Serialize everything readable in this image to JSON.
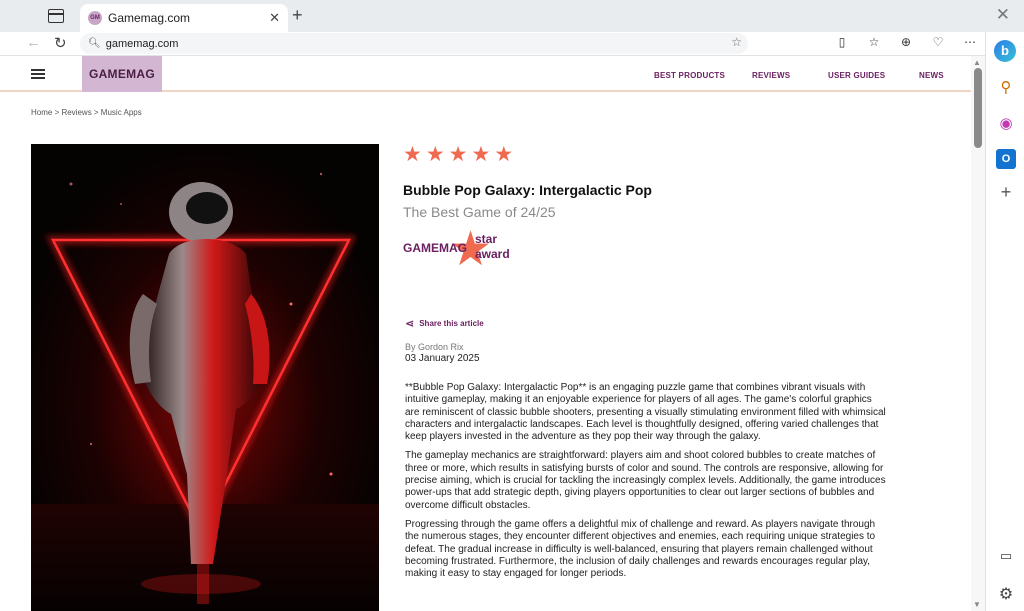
{
  "browser": {
    "tab_title": "Gamemag.com",
    "favicon_text": "GM",
    "address": "gamemag.com"
  },
  "icons": {
    "back": "back-arrow-icon",
    "reload": "reload-icon",
    "favorite": "star-outline-icon",
    "sidebar": [
      "bing-copilot-icon",
      "search-icon",
      "microsoft365-icon",
      "outlook-icon",
      "add-icon",
      "sidebar-panel-icon",
      "settings-icon"
    ]
  },
  "site": {
    "logo": "GAMEMAG",
    "nav": [
      "BEST PRODUCTS",
      "REVIEWS",
      "USER GUIDES",
      "NEWS"
    ],
    "breadcrumb": "Home > Reviews > Music Apps"
  },
  "article": {
    "rating": 5,
    "rating_max": 5,
    "title": "Bubble Pop Galaxy: Intergalactic Pop",
    "subtitle": "The Best Game of 24/25",
    "award_brand": "GAMEMAG",
    "award_label": "star\naward",
    "share_label": "Share this article",
    "author": "By Gordon Rix",
    "date": "03 January 2025",
    "paragraphs": [
      "**Bubble Pop Galaxy: Intergalactic Pop** is an engaging puzzle game that combines vibrant visuals with intuitive gameplay, making it an enjoyable experience for players of all ages. The game's colorful graphics are reminiscent of classic bubble shooters, presenting a visually stimulating environment filled with whimsical characters and intergalactic landscapes. Each level is thoughtfully designed, offering varied challenges that keep players invested in the adventure as they pop their way through the galaxy.",
      "The gameplay mechanics are straightforward: players aim and shoot colored bubbles to create matches of three or more, which results in satisfying bursts of color and sound. The controls are responsive, allowing for precise aiming, which is crucial for tackling the increasingly complex levels. Additionally, the game introduces power-ups that add strategic depth, giving players opportunities to clear out larger sections of bubbles and overcome difficult obstacles.",
      "Progressing through the game offers a delightful mix of challenge and reward. As players navigate through the numerous stages, they encounter different objectives and enemies, each requiring unique strategies to defeat. The gradual increase in difficulty is well-balanced, ensuring that players remain challenged without becoming frustrated. Furthermore, the inclusion of daily challenges and rewards encourages regular play, making it easy to stay engaged for longer periods."
    ]
  },
  "colors": {
    "brand": "#6b2061",
    "logo_bg": "#d3b6d1",
    "star": "#ef6a4f",
    "neon": "#ff1a1a"
  }
}
